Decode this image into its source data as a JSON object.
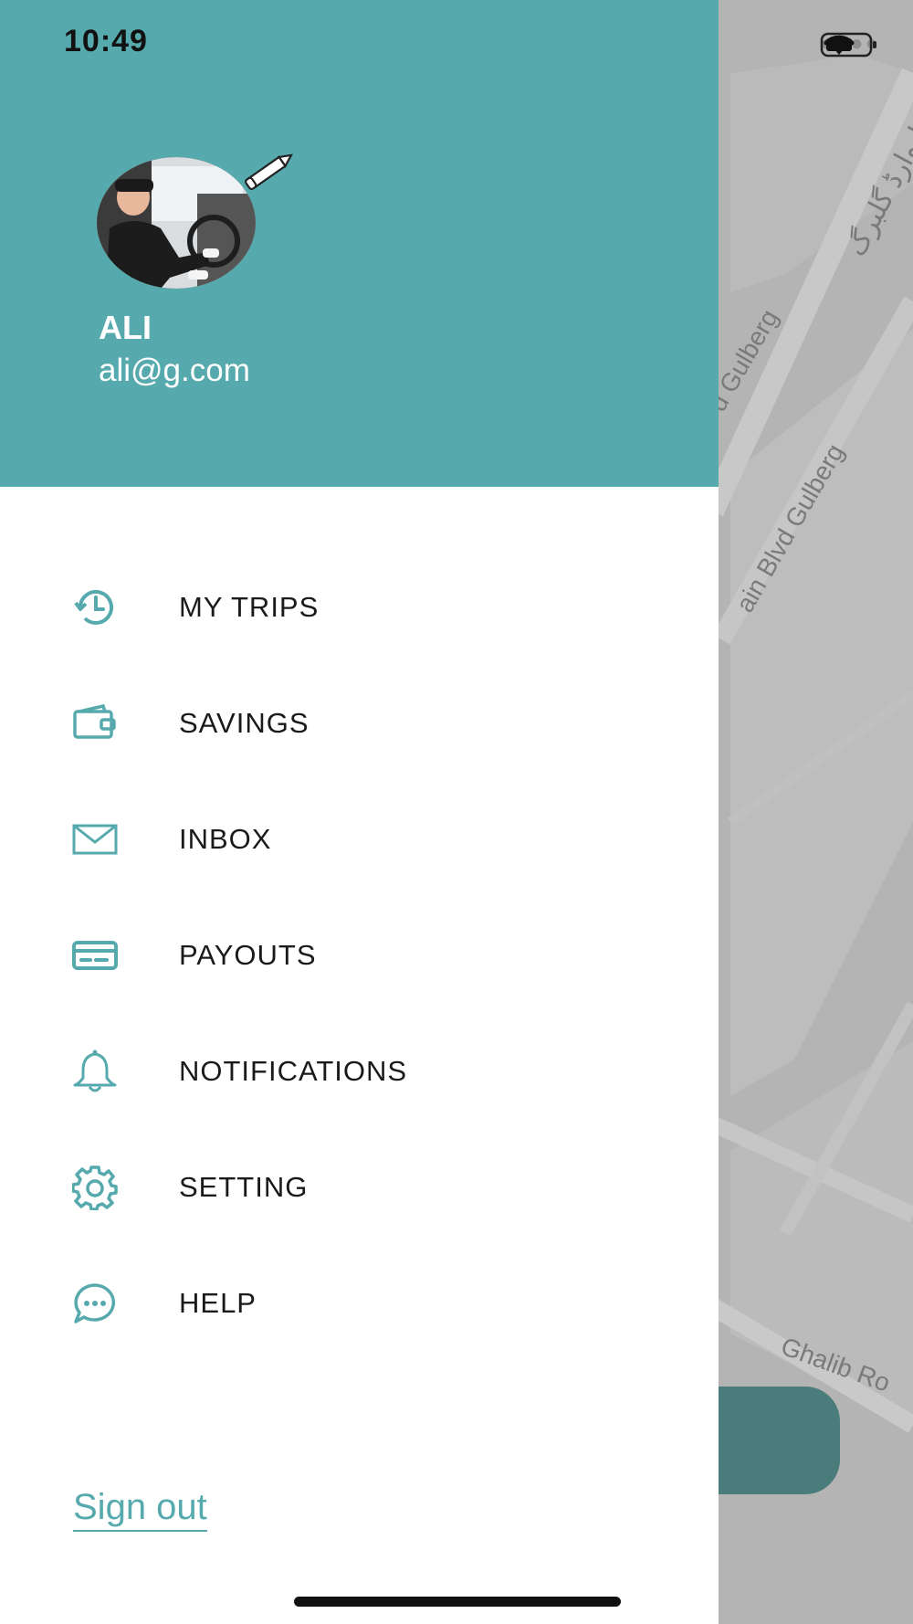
{
  "status_bar": {
    "time": "10:49"
  },
  "profile": {
    "name": "ALI",
    "email": "ali@g.com"
  },
  "menu": [
    {
      "label": "MY TRIPS",
      "icon": "history-icon"
    },
    {
      "label": "SAVINGS",
      "icon": "wallet-icon"
    },
    {
      "label": "INBOX",
      "icon": "mail-icon"
    },
    {
      "label": "PAYOUTS",
      "icon": "card-icon"
    },
    {
      "label": "NOTIFICATIONS",
      "icon": "bell-icon"
    },
    {
      "label": "SETTING",
      "icon": "gear-icon"
    },
    {
      "label": "HELP",
      "icon": "chat-icon"
    }
  ],
  "sign_out_label": "Sign out",
  "map": {
    "labels": [
      "d Gulberg",
      "ain Blvd Gulberg",
      "Ghalib Ro",
      "بولیوارڈ گلبرگ"
    ]
  },
  "colors": {
    "accent": "#56aaad",
    "map_button": "#4a7c7c",
    "map_bg": "#b3b3b3"
  }
}
